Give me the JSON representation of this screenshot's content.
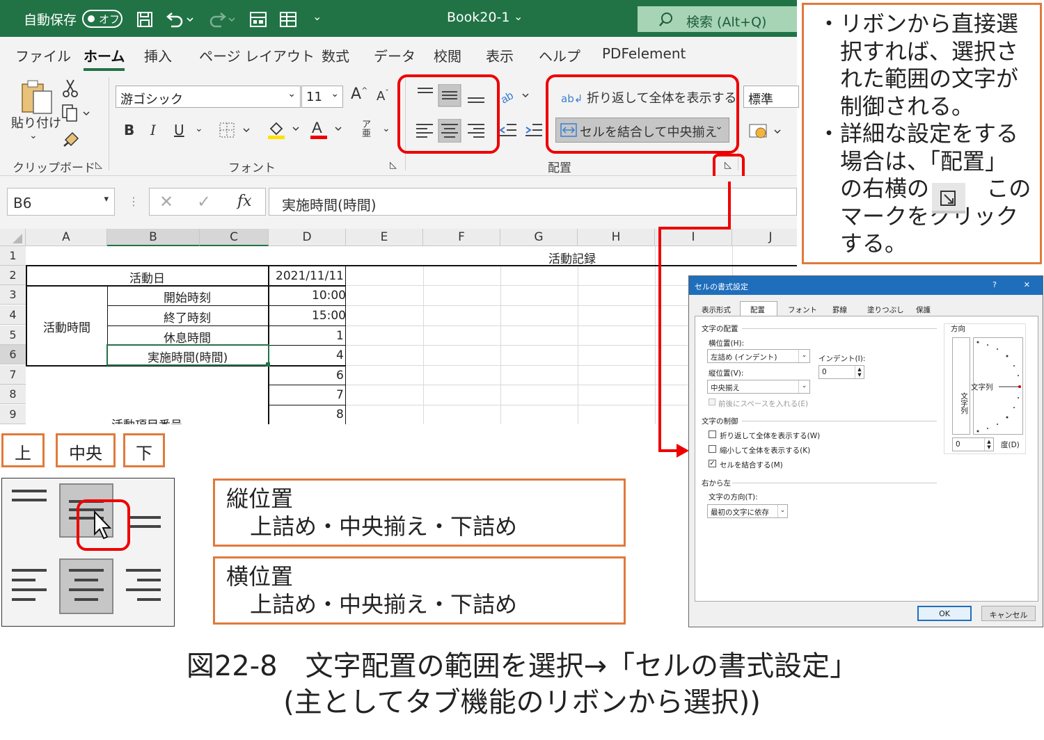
{
  "window": {
    "autosave_label": "自動保存",
    "autosave_state": "オフ",
    "filename": "Book20-1",
    "filename_arrow": "⌄",
    "search_label": "検索 (Alt+Q)"
  },
  "tabs": [
    "ファイル",
    "ホーム",
    "挿入",
    "ページ レイアウト",
    "数式",
    "データ",
    "校閲",
    "表示",
    "ヘルプ",
    "PDFelement"
  ],
  "ribbon": {
    "paste_label": "貼り付け",
    "clipboard_group": "クリップボード",
    "font_name": "游ゴシック",
    "font_size": "11",
    "font_group": "フォント",
    "bold": "B",
    "italic": "I",
    "underline": "U",
    "wrap_text": "折り返して全体を表示する",
    "merge_center": "セルを結合して中央揃え",
    "alignment_group": "配置",
    "number_format": "標準"
  },
  "formula_bar": {
    "name_box": "B6",
    "fx": "fx",
    "formula": "実施時間(時間)"
  },
  "sheet": {
    "columns": [
      "A",
      "B",
      "C",
      "D",
      "E",
      "F",
      "G",
      "H",
      "I",
      "J"
    ],
    "rows": [
      "1",
      "2",
      "3",
      "4",
      "5",
      "6",
      "7",
      "8",
      "9"
    ],
    "title": "活動記録",
    "activity_day_label": "活動日",
    "activity_day_value": "2021/11/11",
    "activity_time_label": "活動時間",
    "start_label": "開始時刻",
    "start_value": "10:00",
    "end_label": "終了時刻",
    "end_value": "15:00",
    "break_label": "休息時間",
    "break_value": "1",
    "duration_label": "実施時間(時間)",
    "duration_value": "4",
    "row7_value": "6",
    "row8_value": "7",
    "row9_value": "8",
    "row9_label": "活動項目番号"
  },
  "note": {
    "b1": "・",
    "line1": "リボンから直接選",
    "line2": "択すれば、選択さ",
    "line3": "れた範囲の文字が",
    "line4": "制御される。",
    "b2": "・",
    "line5": "詳細な設定をする",
    "line6": "場合は、「配置」",
    "line7a": "の右横の",
    "line7b": "この",
    "line8": "マークをクリック",
    "line9": "する。"
  },
  "vertical_labels": {
    "top": "上",
    "middle": "中央",
    "bottom": "下"
  },
  "explain": {
    "v_title": "縦位置",
    "v_body": "上詰め・中央揃え・下詰め",
    "h_title": "横位置",
    "h_body": "上詰め・中央揃え・下詰め"
  },
  "dialog": {
    "title": "セルの書式設定",
    "help": "?",
    "close": "✕",
    "tabs": [
      "表示形式",
      "配置",
      "フォント",
      "罫線",
      "塗りつぶし",
      "保護"
    ],
    "text_alignment": "文字の配置",
    "horizontal_label": "横位置(H):",
    "horizontal_value": "左詰め (インデント)",
    "indent_label": "インデント(I):",
    "indent_value": "0",
    "vertical_label": "縦位置(V):",
    "vertical_value": "中央揃え",
    "justify_distributed": "前後にスペースを入れる(E)",
    "text_control": "文字の制御",
    "wrap": "折り返して全体を表示する(W)",
    "shrink": "縮小して全体を表示する(K)",
    "merge": "セルを結合する(M)",
    "rtl": "右から左",
    "direction_label": "文字の方向(T):",
    "direction_value": "最初の文字に依存",
    "orientation": "方向",
    "vertical_text": "文字列",
    "orientation_text": "文字列",
    "degree_value": "0",
    "degree_label": "度(D)",
    "ok": "OK",
    "cancel": "キャンセル"
  },
  "caption": {
    "line1": "図22-8　文字配置の範囲を選択→「セルの書式設定」",
    "line2": "(主としてタブ機能のリボンから選択))"
  }
}
